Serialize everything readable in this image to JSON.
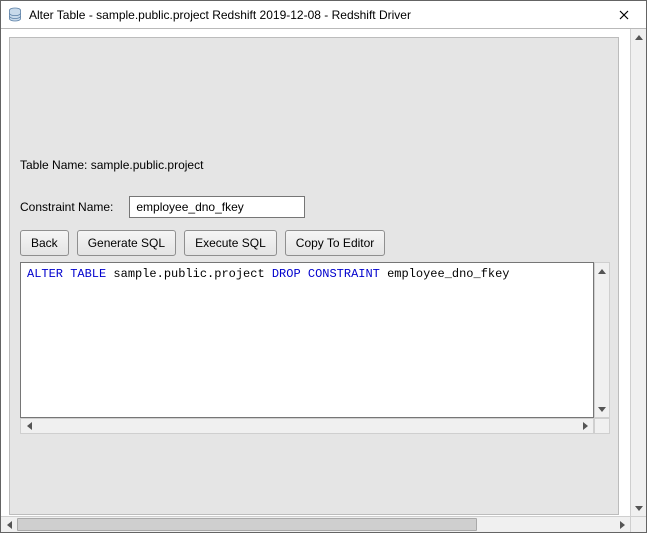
{
  "window": {
    "title": "Alter Table - sample.public.project Redshift 2019-12-08 - Redshift Driver"
  },
  "panel": {
    "table_name_label": "Table Name: sample.public.project",
    "constraint_label": "Constraint Name:",
    "constraint_value": "employee_dno_fkey"
  },
  "buttons": {
    "back": "Back",
    "generate_sql": "Generate SQL",
    "execute_sql": "Execute SQL",
    "copy_to_editor": "Copy To Editor"
  },
  "sql": {
    "kw_alter_table": "ALTER TABLE",
    "target": " sample.public.project ",
    "kw_drop_constraint": "DROP CONSTRAINT",
    "constraint": " employee_dno_fkey"
  }
}
